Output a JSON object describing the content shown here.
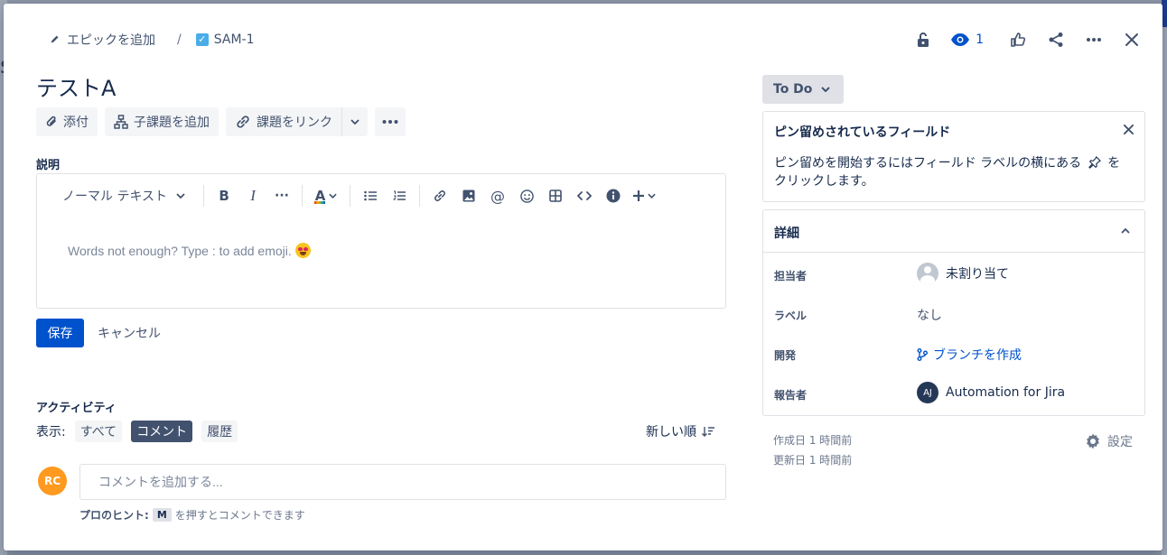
{
  "breadcrumb": {
    "add_epic": "エピックを追加",
    "separator": "/",
    "issue_key": "SAM-1"
  },
  "top_actions": {
    "watch_count": "1"
  },
  "issue": {
    "title": "テストA"
  },
  "action_buttons": {
    "attach": "添付",
    "add_child": "子課題を追加",
    "link_issue": "課題をリンク"
  },
  "description": {
    "label": "説明",
    "text_style": "ノーマル テキスト",
    "placeholder": "Words not enough? Type : to add emoji."
  },
  "form": {
    "save": "保存",
    "cancel": "キャンセル"
  },
  "activity": {
    "title": "アクティビティ",
    "show_label": "表示:",
    "filters": [
      "すべて",
      "コメント",
      "履歴"
    ],
    "active_filter": "コメント",
    "sort": "新しい順",
    "avatar_initials": "RC",
    "comment_placeholder": "コメントを追加する...",
    "tip_prefix": "プロのヒント:",
    "tip_key": "M",
    "tip_suffix": "を押すとコメントできます"
  },
  "status": {
    "label": "To Do"
  },
  "pinned": {
    "title": "ピン留めされているフィールド",
    "text_before": "ピン留めを開始するにはフィールド ラベルの横にある",
    "text_after": "を",
    "text_line2": "クリックします。"
  },
  "details": {
    "title": "詳細",
    "fields": {
      "assignee_label": "担当者",
      "assignee_value": "未割り当て",
      "labels_label": "ラベル",
      "labels_value": "なし",
      "development_label": "開発",
      "development_value": "ブランチを作成",
      "reporter_label": "報告者",
      "reporter_initials": "AJ",
      "reporter_value": "Automation for Jira"
    }
  },
  "footer": {
    "created": "作成日 1 時間前",
    "updated": "更新日 1 時間前",
    "settings": "設定"
  },
  "colors": {
    "primary": "#0052cc",
    "text": "#172b4d",
    "subtle": "#42526e",
    "avatar_rc": "#ff991f"
  }
}
